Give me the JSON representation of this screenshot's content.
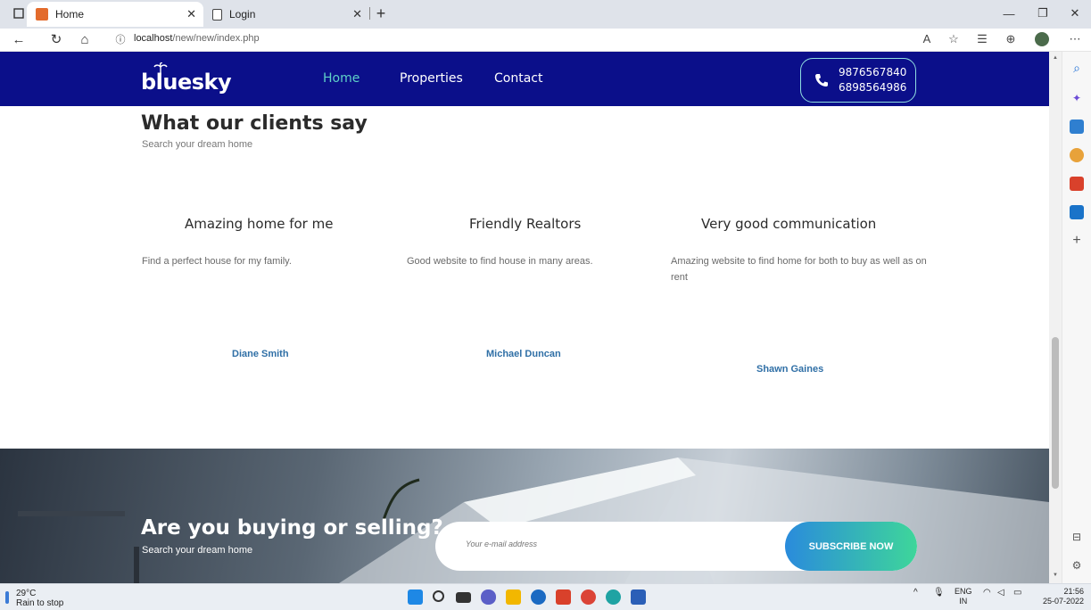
{
  "browser": {
    "tabs": [
      {
        "label": "Home",
        "active": true
      },
      {
        "label": "Login",
        "active": false
      }
    ],
    "new_tab": "+",
    "url_host": "localhost",
    "url_path": "/new/new/index.php"
  },
  "header": {
    "logo": "bluesky",
    "nav": [
      "Home",
      "Properties",
      "Contact"
    ],
    "phones": [
      "9876567840",
      "6898564986"
    ],
    "brand_color": "#0b0f8a",
    "active_nav_color": "#5fd1c8"
  },
  "testimonials": {
    "title": "What our clients say",
    "subtitle": "Search your dream home",
    "items": [
      {
        "title": "Amazing home for me",
        "text": "Find a perfect house for my family.",
        "name": "Diane Smith"
      },
      {
        "title": "Friendly Realtors",
        "text": "Good website to find house in many areas.",
        "name": "Michael Duncan"
      },
      {
        "title": "Very good communication",
        "text": "Amazing website to find home for both to buy as well as on rent",
        "name": "Shawn Gaines"
      }
    ]
  },
  "banner": {
    "title": "Are you buying or selling?",
    "subtitle": "Search your dream home",
    "email_placeholder": "Your e-mail address",
    "button": "SUBSCRIBE NOW"
  },
  "taskbar": {
    "temp": "29°C",
    "weather": "Rain to stop",
    "lang": "ENG",
    "region": "IN",
    "time": "21:56",
    "date": "25-07-2022"
  }
}
